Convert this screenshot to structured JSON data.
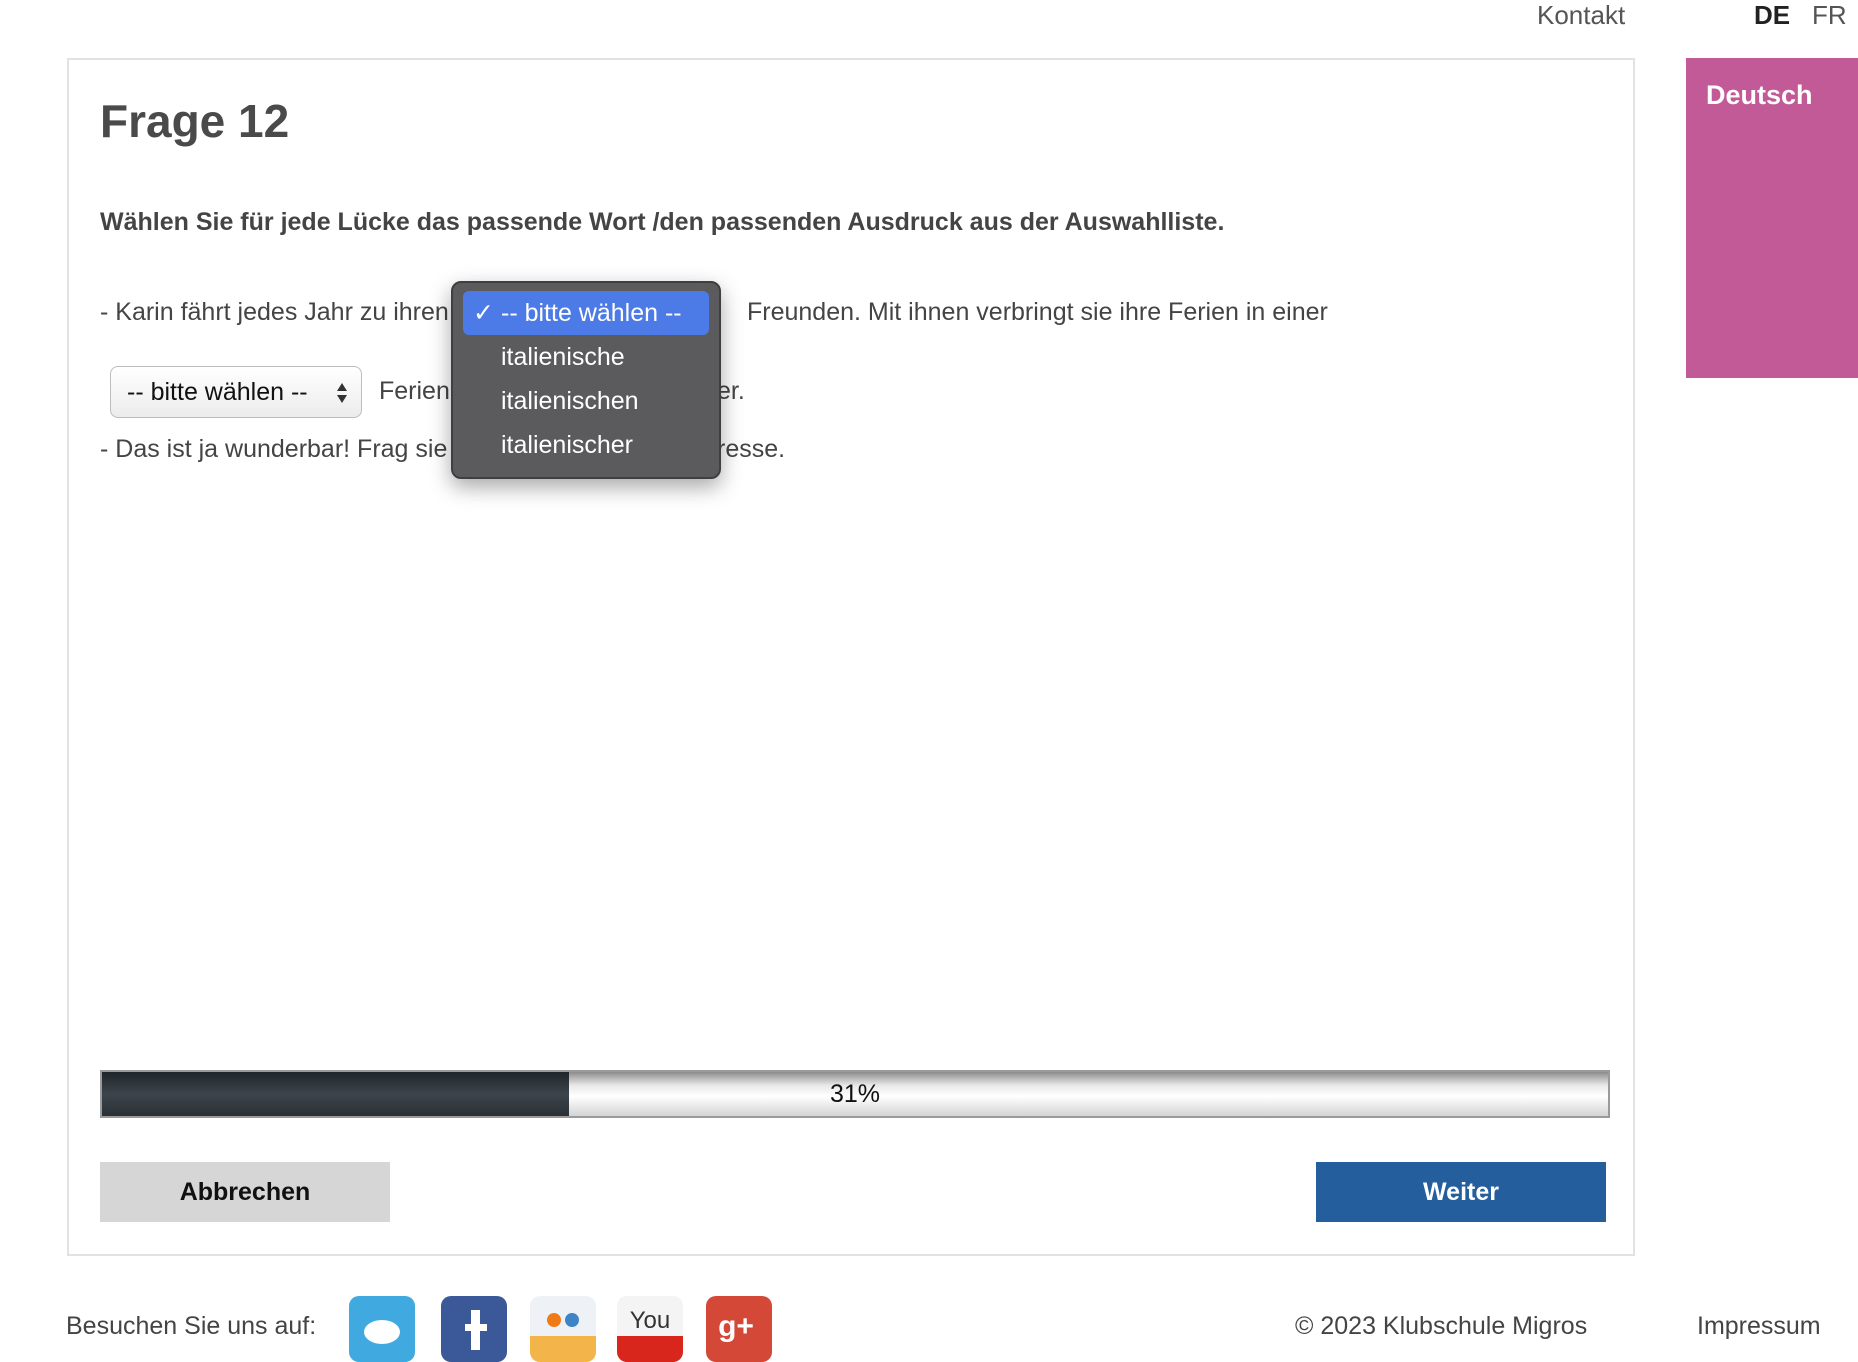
{
  "header": {
    "contact": "Kontakt",
    "languages": [
      "DE",
      "FR"
    ]
  },
  "question": {
    "title": "Frage 12",
    "instruction": "Wählen Sie für jede Lücke das passende Wort /den passenden Ausdruck aus der Auswahlliste.",
    "line1_before": "- Karin fährt jedes Jahr zu ihren",
    "line1_after": "Freunden. Mit ihnen verbringt sie ihre Ferien in einer",
    "line2_select": "-- bitte wählen --",
    "line2_before": "Ferien",
    "line2_after": "er.",
    "line3_before": "- Das ist ja wunderbar! Frag sie",
    "line3_after": "resse."
  },
  "dropdown": {
    "options": [
      "-- bitte wählen --",
      "italienische",
      "italienischen",
      "italienischer"
    ],
    "selected_index": 0
  },
  "progress": {
    "percent": 31,
    "label": "31%"
  },
  "buttons": {
    "cancel": "Abbrechen",
    "next": "Weiter"
  },
  "sidebar": {
    "label": "Deutsch",
    "color": "#c25a98"
  },
  "footer": {
    "visit": "Besuchen Sie uns auf:",
    "copyright": "© 2023 Klubschule Migros",
    "impressum": "Impressum"
  },
  "social_icons": [
    "twitter-icon",
    "facebook-icon",
    "flickr-icon",
    "youtube-icon",
    "google-plus-icon"
  ],
  "colors": {
    "accent_blue": "#245e9c",
    "dropdown_highlight": "#4c7be8"
  }
}
